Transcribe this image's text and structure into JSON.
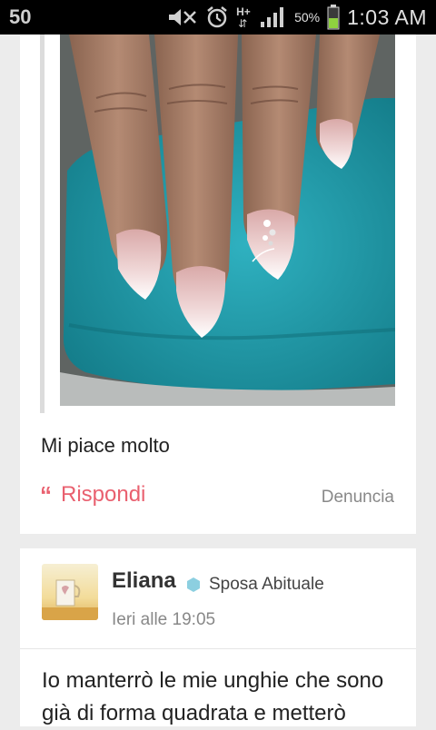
{
  "status_bar": {
    "left_number": "50",
    "battery_percent": "50%",
    "time": "1:03 AM",
    "network_label": "H+",
    "icons": [
      "mute-icon",
      "alarm-icon",
      "data-arrows-icon",
      "signal-icon",
      "battery-icon"
    ],
    "battery_level": 0.5
  },
  "post": {
    "photo_icon": "nail-photo",
    "comment": "Mi piace molto",
    "reply_icon": "quote-icon",
    "reply_label": "Rispondi",
    "report_label": "Denuncia",
    "accent_color": "#e9606f"
  },
  "reply_post": {
    "author": "Eliana",
    "badge_icon": "hexagon-icon",
    "badge_label": "Sposa Abituale",
    "badge_color": "#8ccfe0",
    "timestamp": "Ieri alle 19:05",
    "text": "Io manterrò le mie unghie che sono già di forma quadrata e metterò"
  }
}
